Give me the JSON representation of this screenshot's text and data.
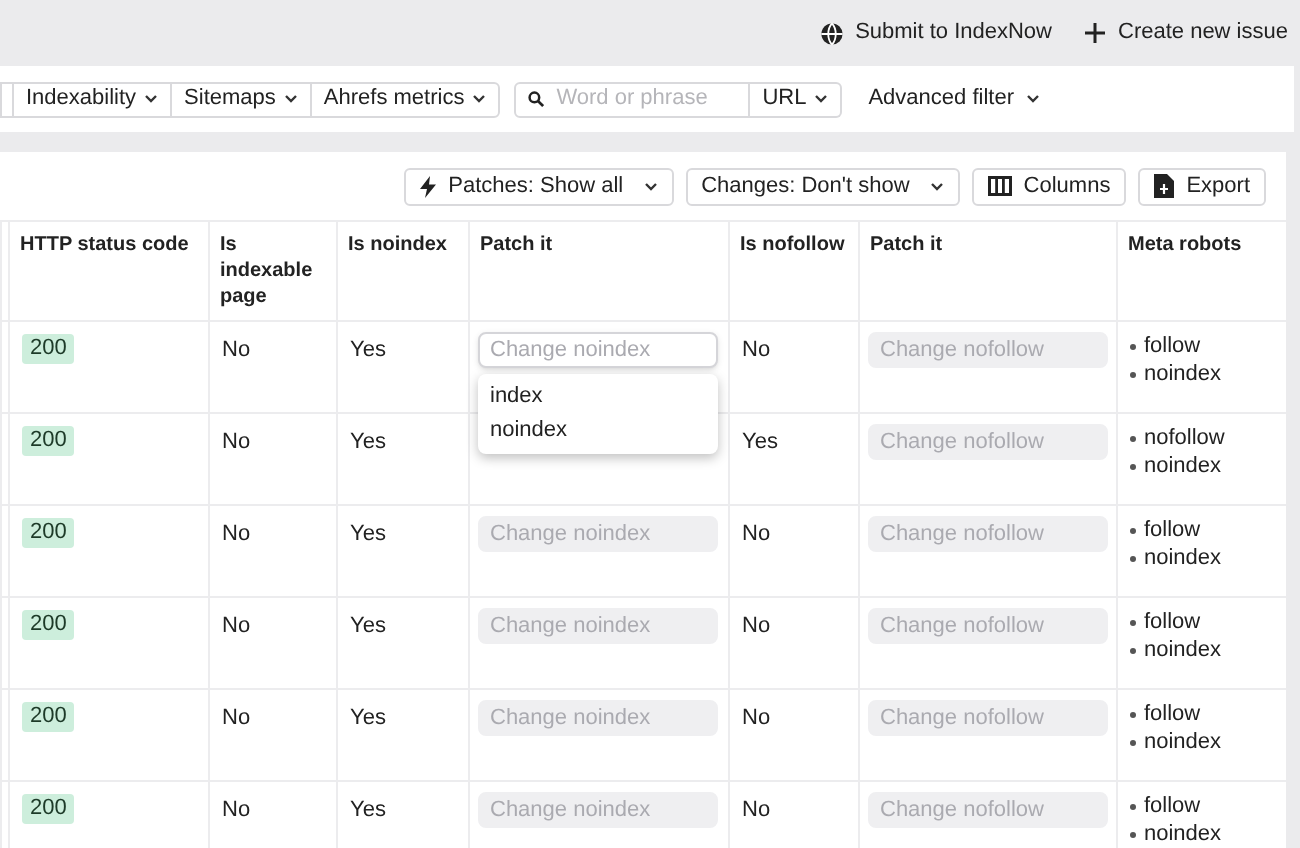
{
  "top_actions": [
    {
      "label": "Submit to IndexNow"
    },
    {
      "label": "Create new issue"
    }
  ],
  "filters": {
    "dropdowns": [
      "Indexability",
      "Sitemaps",
      "Ahrefs metrics"
    ],
    "search": {
      "placeholder": "Word or phrase"
    },
    "scope": "URL",
    "advanced": "Advanced filter"
  },
  "toolbar": [
    {
      "label": "Patches: Show all"
    },
    {
      "label": "Changes: Don't show"
    },
    {
      "label": "Columns"
    },
    {
      "label": "Export"
    }
  ],
  "table": {
    "columns": [
      "HTTP status code",
      "Is indexable page",
      "Is noindex",
      "Patch it",
      "Is nofollow",
      "Patch it",
      "Meta robots"
    ],
    "rows": [
      {
        "status": "200",
        "indexable": "No",
        "noindex": "Yes",
        "noindex_patch": {
          "placeholder": "Change noindex",
          "focused": true,
          "options": [
            "index",
            "noindex"
          ]
        },
        "nofollow": "No",
        "nofollow_patch": {
          "placeholder": "Change nofollow",
          "focused": false
        },
        "meta_robots": [
          "follow",
          "noindex"
        ]
      },
      {
        "status": "200",
        "indexable": "No",
        "noindex": "Yes",
        "nofollow": "Yes",
        "nofollow_patch": {
          "placeholder": "Change nofollow",
          "focused": false
        },
        "meta_robots": [
          "nofollow",
          "noindex"
        ]
      },
      {
        "status": "200",
        "indexable": "No",
        "noindex": "Yes",
        "noindex_patch": {
          "placeholder": "Change noindex",
          "focused": false
        },
        "nofollow": "No",
        "nofollow_patch": {
          "placeholder": "Change nofollow",
          "focused": false
        },
        "meta_robots": [
          "follow",
          "noindex"
        ]
      },
      {
        "status": "200",
        "indexable": "No",
        "noindex": "Yes",
        "noindex_patch": {
          "placeholder": "Change noindex",
          "focused": false
        },
        "nofollow": "No",
        "nofollow_patch": {
          "placeholder": "Change nofollow",
          "focused": false
        },
        "meta_robots": [
          "follow",
          "noindex"
        ]
      },
      {
        "status": "200",
        "indexable": "No",
        "noindex": "Yes",
        "noindex_patch": {
          "placeholder": "Change noindex",
          "focused": false
        },
        "nofollow": "No",
        "nofollow_patch": {
          "placeholder": "Change nofollow",
          "focused": false
        },
        "meta_robots": [
          "follow",
          "noindex"
        ]
      },
      {
        "status": "200",
        "indexable": "No",
        "noindex": "Yes",
        "noindex_patch": {
          "placeholder": "Change noindex",
          "focused": false
        },
        "nofollow": "No",
        "nofollow_patch": {
          "placeholder": "Change nofollow",
          "focused": false
        },
        "meta_robots": [
          "follow",
          "noindex"
        ]
      }
    ]
  }
}
